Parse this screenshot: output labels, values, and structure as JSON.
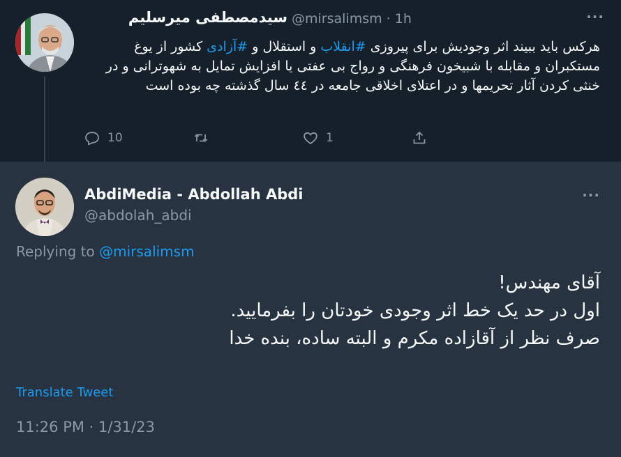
{
  "parent_tweet": {
    "author_name": "سیدمصطفی میرسلیم",
    "author_handle": "@mirsalimsm",
    "separator": "·",
    "time_ago": "1h",
    "text_part1": "هرکس باید ببیند اثر وجودیش برای پیروزی ",
    "hashtag1": "#انقلاب",
    "text_part2": " و استقلال و ",
    "hashtag2": "#آزادی",
    "text_part3": " کشور از یوغ مستکبران و مقابله با شبیخون فرهنگی و رواج بی عفتی یا  افزایش تمایل به شهوترانی و در خنثی کردن آثار تحریمها و در اعتلای اخلاقی جامعه در ٤٤ سال گذشته چه بوده است",
    "actions": {
      "reply_count": "10",
      "retweet_count": "",
      "like_count": "1"
    }
  },
  "reply_tweet": {
    "author_name": "AbdiMedia - Abdollah Abdi",
    "author_handle": "@abdolah_abdi",
    "replying_label": "Replying to ",
    "replying_to": "@mirsalimsm",
    "text_line1": "آقای مهندس!",
    "text_line2": "اول در حد یک خط اثر وجودی خودتان را بفرمایید.",
    "text_line3": "صرف نظر از آقازاده مکرم و البته ساده، بنده خدا",
    "translate_label": "Translate Tweet",
    "timestamp": "11:26 PM · 1/31/23"
  },
  "icons": [
    "reply-icon",
    "retweet-icon",
    "like-icon",
    "share-icon",
    "more-icon"
  ],
  "colors": {
    "background_parent": "#15202b",
    "background_reply": "#273340",
    "link": "#1d9bf0",
    "muted": "#8b98a5",
    "text": "#f7f9f9"
  }
}
